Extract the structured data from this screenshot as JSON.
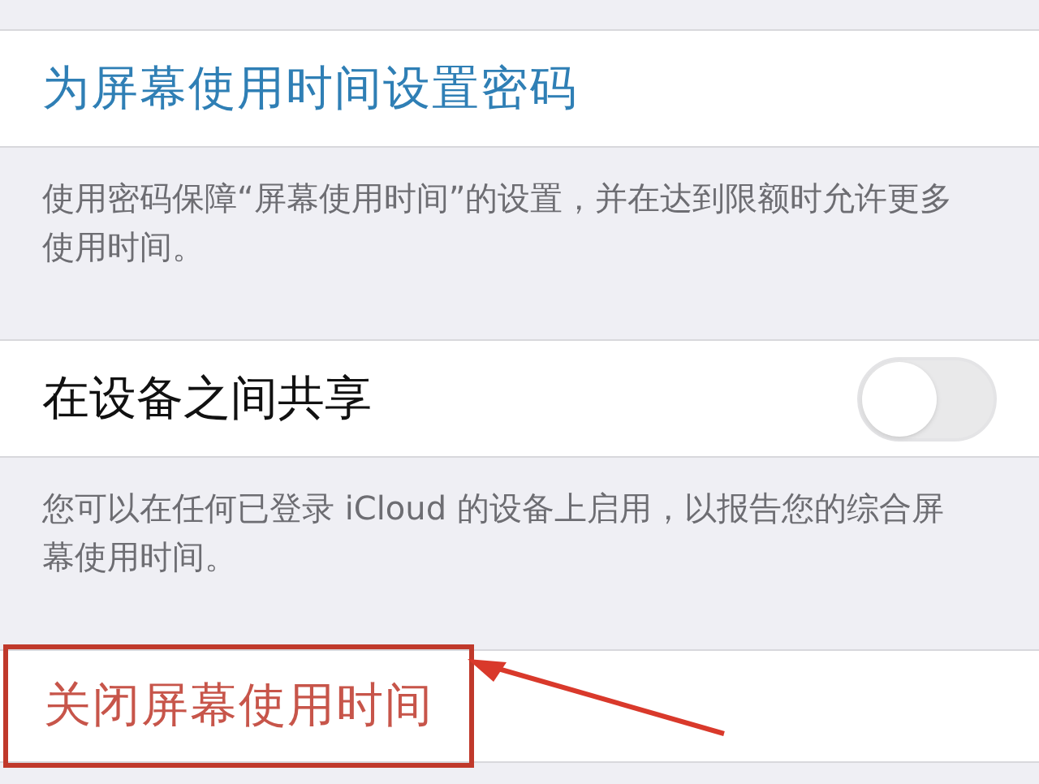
{
  "sections": [
    {
      "kind": "link",
      "label": "为屏幕使用时间设置密码",
      "footer": "使用密码保障“屏幕使用时间”的设置，并在达到限额时允许更多使用时间。"
    },
    {
      "kind": "toggle",
      "label": "在设备之间共享",
      "on": false,
      "footer": "您可以在任何已登录 iCloud 的设备上启用，以报告您的综合屏幕使用时间。"
    },
    {
      "kind": "destructive",
      "label": "关闭屏幕使用时间",
      "highlighted": true
    }
  ]
}
